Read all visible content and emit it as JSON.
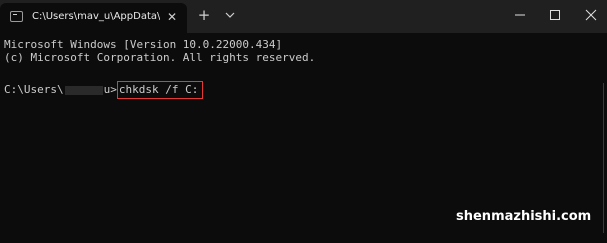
{
  "tab": {
    "title": "C:\\Users\\mav_u\\AppData\\Roam",
    "close_glyph": "✕",
    "icon": "terminal-icon"
  },
  "toolbar": {
    "new_tab_glyph": "+",
    "dropdown_icon": "chevron-down-icon"
  },
  "window_controls": {
    "minimize_icon": "minimize-icon",
    "maximize_icon": "maximize-icon",
    "close_icon": "close-icon"
  },
  "terminal": {
    "line1": "Microsoft Windows [Version 10.0.22000.434]",
    "line2": "(c) Microsoft Corporation. All rights reserved.",
    "prompt_prefix": "C:\\Users\\",
    "prompt_suffix": "u>",
    "command": "chkdsk /f C:"
  },
  "watermark": "shenmazhishi.com",
  "colors": {
    "background": "#0c0c0c",
    "titlebar": "#202020",
    "text": "#cccccc",
    "highlight_border": "#e53935"
  }
}
